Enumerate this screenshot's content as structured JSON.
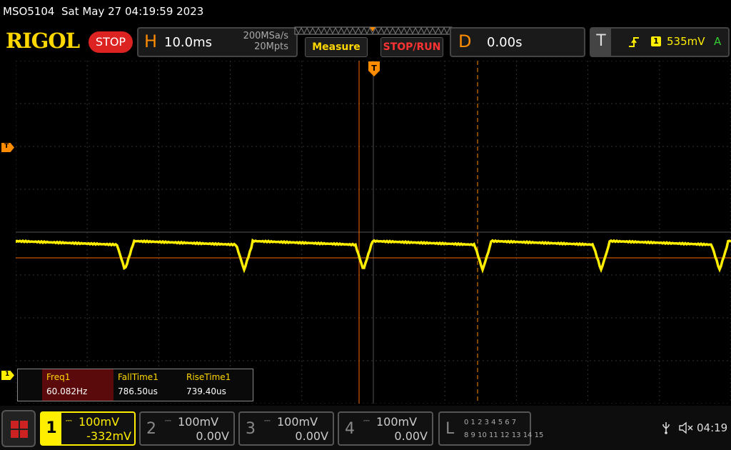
{
  "titlebar": {
    "model": "MSO5104",
    "datetime": "Sat May 27 04:19:59 2023"
  },
  "logo": "RIGOL",
  "run_state": "STOP",
  "horizontal": {
    "key": "H",
    "scale": "10.0ms",
    "sample_rate": "200MSa/s",
    "memory_depth": "20Mpts"
  },
  "buttons": {
    "measure": "Measure",
    "stop_run": "STOP/RUN"
  },
  "delay": {
    "key": "D",
    "value": "0.00s"
  },
  "trigger": {
    "key": "T",
    "source": "1",
    "level": "535mV",
    "mode": "A"
  },
  "markers": {
    "trigger_level": "T",
    "channel1": "1"
  },
  "measurements": [
    {
      "label": "Freq1",
      "value": "60.082Hz"
    },
    {
      "label": "FallTime1",
      "value": "786.50us"
    },
    {
      "label": "RiseTime1",
      "value": "739.40us"
    }
  ],
  "channels": [
    {
      "num": "1",
      "scale": "100mV",
      "offset": "-332mV",
      "active": true
    },
    {
      "num": "2",
      "scale": "100mV",
      "offset": "0.00V",
      "active": false
    },
    {
      "num": "3",
      "scale": "100mV",
      "offset": "0.00V",
      "active": false
    },
    {
      "num": "4",
      "scale": "100mV",
      "offset": "0.00V",
      "active": false
    }
  ],
  "logic": {
    "key": "L",
    "row1": "0 1 2 3  4 5 6 7",
    "row2": "8 9 10 11 12 13 14 15"
  },
  "status": {
    "time": "04:19"
  },
  "colors": {
    "ch1": "#ffee00",
    "accent": "#ff8c00",
    "stop": "#dd2222"
  }
}
